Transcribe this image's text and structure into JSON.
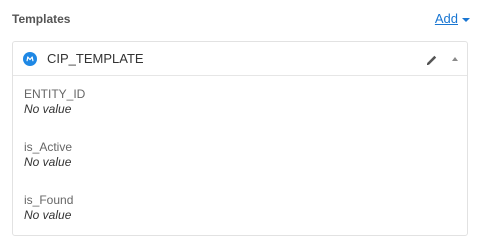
{
  "section": {
    "title": "Templates",
    "add_label": "Add"
  },
  "template": {
    "name": "CIP_TEMPLATE",
    "badge_letter": "M",
    "badge_color": "#1e88e5",
    "icons": {
      "edit": "pencil-icon",
      "collapse": "caret-up-icon"
    },
    "fields": [
      {
        "label": "ENTITY_ID",
        "value": "No value"
      },
      {
        "label": "is_Active",
        "value": "No value"
      },
      {
        "label": "is_Found",
        "value": "No value"
      }
    ]
  },
  "colors": {
    "link": "#1976d2",
    "border": "#e2e2e2"
  }
}
